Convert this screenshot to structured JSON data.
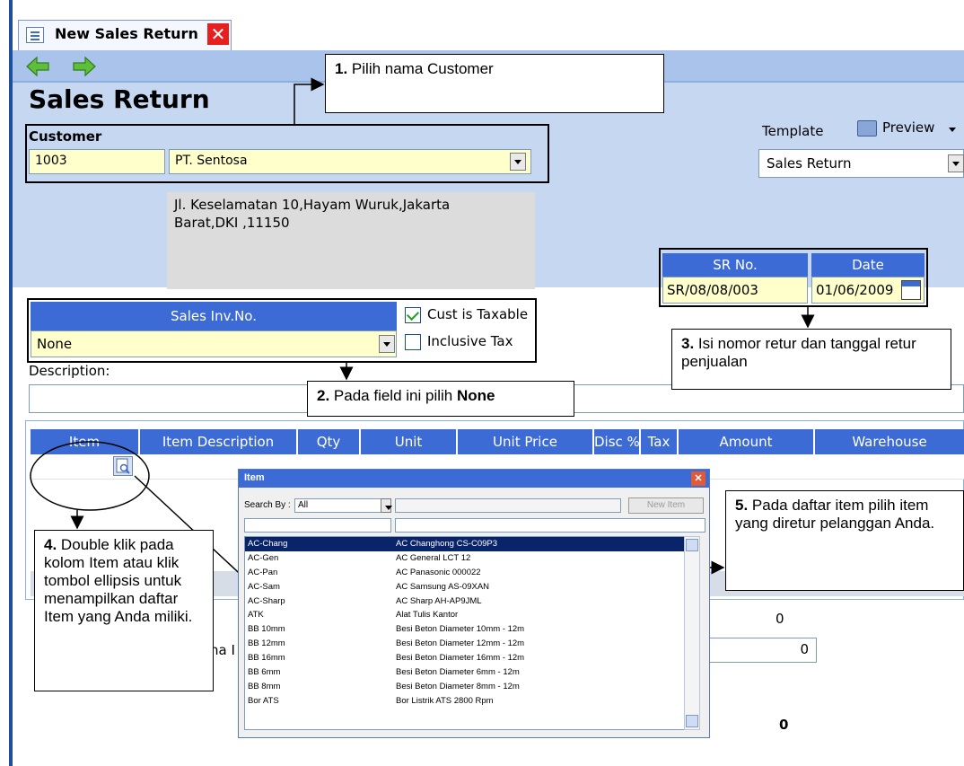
{
  "tab": {
    "title": "New Sales Return",
    "close_glyph": "✕"
  },
  "page": {
    "title": "Sales Return"
  },
  "customer": {
    "label": "Customer",
    "id": "1003",
    "name": "PT. Sentosa",
    "address_line1": "Jl. Keselamatan 10,Hayam Wuruk,Jakarta",
    "address_line2": "Barat,DKI ,11150"
  },
  "template": {
    "label": "Template",
    "preview_label": "Preview",
    "value": "Sales Return"
  },
  "sr": {
    "no_label": "SR No.",
    "no_value": "SR/08/08/003",
    "date_label": "Date",
    "date_value": "01/06/2009"
  },
  "sales_inv": {
    "label": "Sales Inv.No.",
    "value": "None"
  },
  "options": {
    "cust_taxable_label": "Cust is Taxable",
    "cust_taxable": true,
    "inclusive_tax_label": "Inclusive Tax",
    "inclusive_tax": false
  },
  "description": {
    "label": "Description:"
  },
  "grid": {
    "columns": [
      "Item",
      "Item Description",
      "Qty",
      "Unit",
      "Unit Price",
      "Disc %",
      "Tax",
      "Amount",
      "Warehouse"
    ]
  },
  "summary": {
    "subtotal": "0",
    "total": "0",
    "grand_total": "0",
    "partial_label": "ha I"
  },
  "popup": {
    "title": "Item",
    "search_by_label": "Search By :",
    "search_by_value": "All",
    "new_item_label": "New Item",
    "items": [
      {
        "code": "AC-Chang",
        "name": "AC Changhong CS-C09P3"
      },
      {
        "code": "AC-Gen",
        "name": "AC General LCT 12"
      },
      {
        "code": "AC-Pan",
        "name": "AC Panasonic 000022"
      },
      {
        "code": "AC-Sam",
        "name": "AC Samsung AS-09XAN"
      },
      {
        "code": "AC-Sharp",
        "name": "AC Sharp AH-AP9JML"
      },
      {
        "code": "ATK",
        "name": "Alat Tulis Kantor"
      },
      {
        "code": "BB 10mm",
        "name": "Besi Beton Diameter 10mm - 12m"
      },
      {
        "code": "BB 12mm",
        "name": "Besi Beton Diameter 12mm - 12m"
      },
      {
        "code": "BB 16mm",
        "name": "Besi Beton Diameter 16mm - 12m"
      },
      {
        "code": "BB 6mm",
        "name": "Besi Beton Diameter 6mm - 12m"
      },
      {
        "code": "BB 8mm",
        "name": "Besi Beton Diameter 8mm - 12m"
      },
      {
        "code": "Bor ATS",
        "name": "Bor Listrik ATS 2800 Rpm"
      }
    ]
  },
  "notes": {
    "n1_num": "1.",
    "n1_text": "Pilih nama Customer",
    "n2_num": "2.",
    "n2_text": "Pada field ini pilih ",
    "n2_bold": "None",
    "n3_num": "3.",
    "n3_text": "Isi nomor retur dan tanggal retur penjualan",
    "n4_num": "4.",
    "n4_text": "Double klik pada kolom Item atau klik tombol ellipsis untuk menampilkan daftar Item yang Anda miliki.",
    "n5_num": "5.",
    "n5_text": "Pada daftar item pilih item yang diretur pelanggan Anda."
  },
  "colors": {
    "header_blue": "#3d6bd6",
    "field_yellow": "#ffffcc",
    "band": "#c6d7f2"
  },
  "icons": {
    "back": "left-arrow-icon",
    "forward": "right-arrow-icon",
    "calendar": "calendar-icon",
    "printer": "printer-icon"
  }
}
